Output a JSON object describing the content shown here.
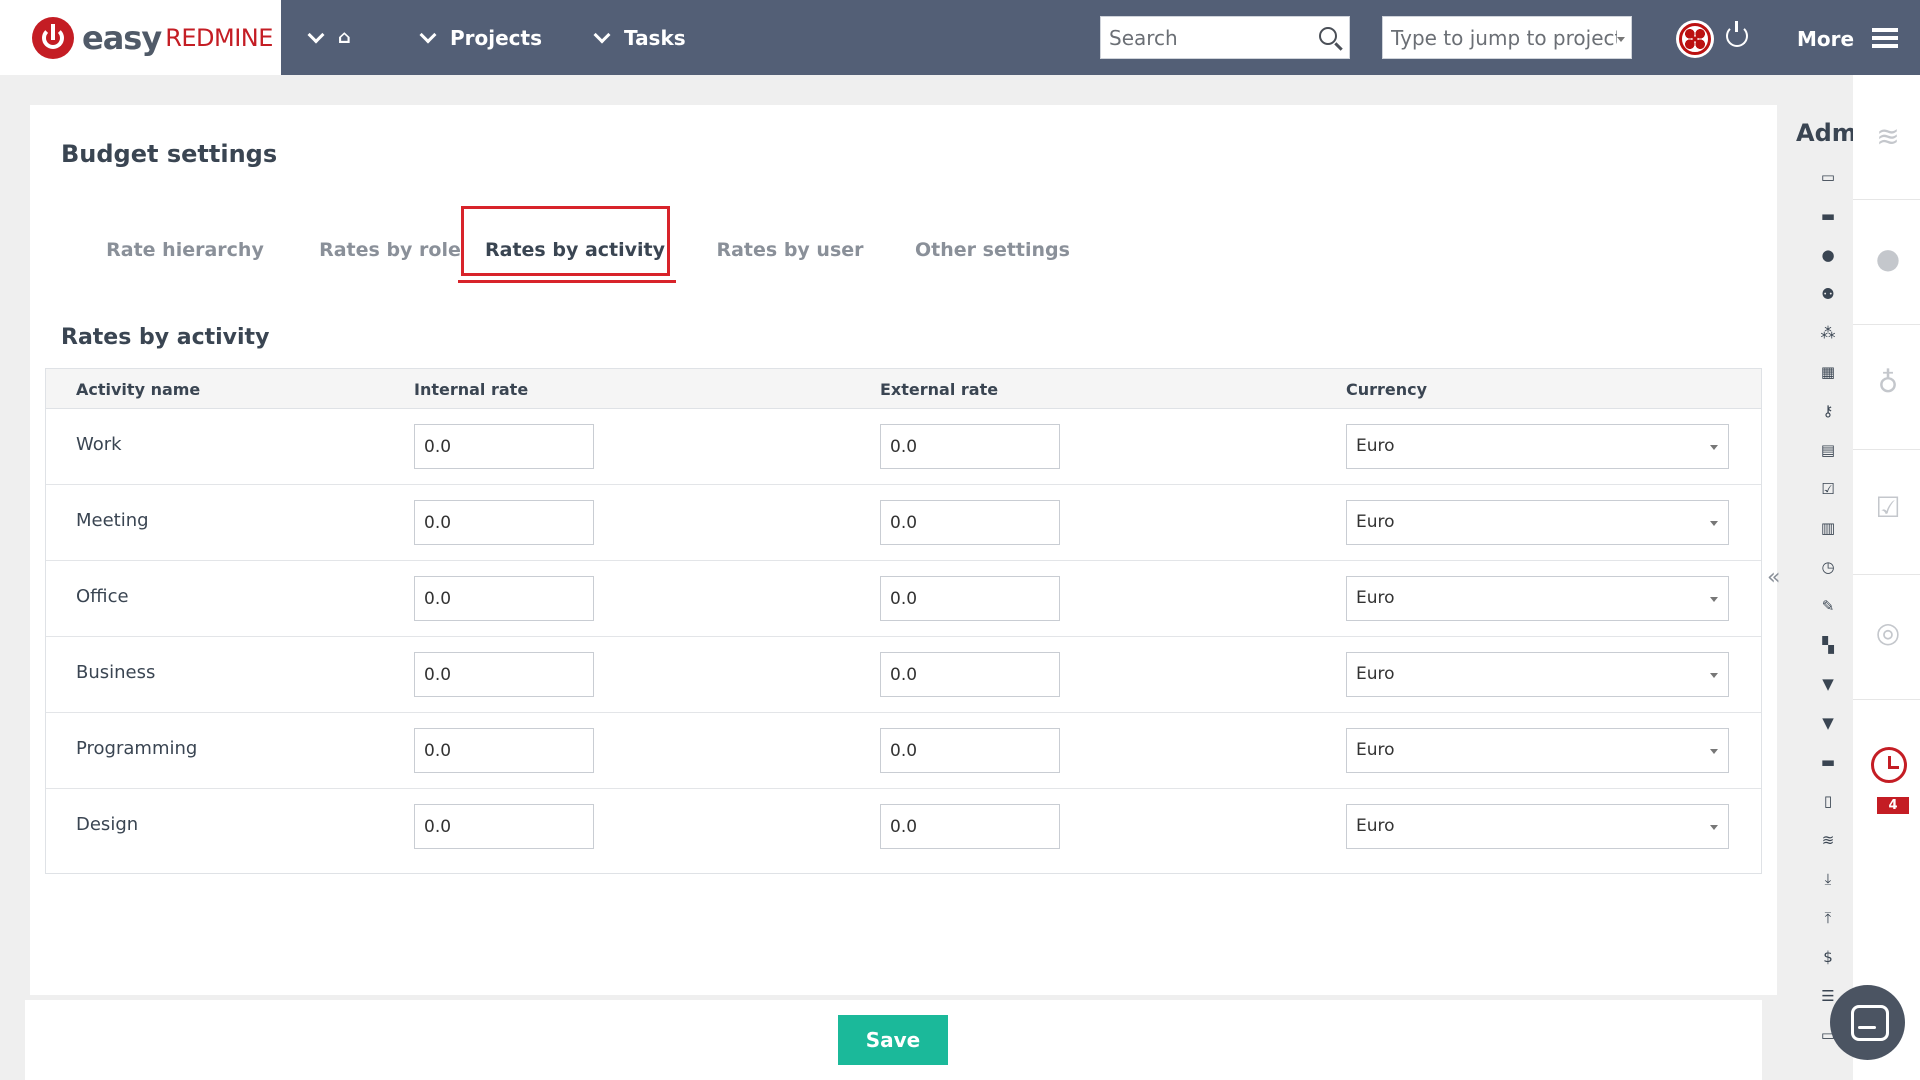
{
  "topbar": {
    "logo_easy": "easy",
    "logo_redmine": "REDMINE",
    "nav": [
      {
        "label": "Projects"
      },
      {
        "label": "Tasks"
      }
    ],
    "search_placeholder": "Search",
    "jump_placeholder": "Type to jump to project",
    "more_label": "More"
  },
  "page": {
    "title": "Budget settings",
    "tabs": [
      {
        "label": "Rate hierarchy"
      },
      {
        "label": "Rates by role"
      },
      {
        "label": "Rates by activity"
      },
      {
        "label": "Rates by user"
      },
      {
        "label": "Other settings"
      }
    ],
    "active_tab": "Rates by activity",
    "section_title": "Rates by activity"
  },
  "table": {
    "headers": {
      "name": "Activity name",
      "internal": "Internal rate",
      "external": "External rate",
      "currency": "Currency"
    },
    "rows": [
      {
        "name": "Work",
        "internal": "0.0",
        "external": "0.0",
        "currency": "Euro"
      },
      {
        "name": "Meeting",
        "internal": "0.0",
        "external": "0.0",
        "currency": "Euro"
      },
      {
        "name": "Office",
        "internal": "0.0",
        "external": "0.0",
        "currency": "Euro"
      },
      {
        "name": "Business",
        "internal": "0.0",
        "external": "0.0",
        "currency": "Euro"
      },
      {
        "name": "Programming",
        "internal": "0.0",
        "external": "0.0",
        "currency": "Euro"
      },
      {
        "name": "Design",
        "internal": "0.0",
        "external": "0.0",
        "currency": "Euro"
      }
    ]
  },
  "footer": {
    "save_label": "Save"
  },
  "admin": {
    "label": "Admi",
    "icons": [
      "folder-icon",
      "folder-filled-icon",
      "user-icon",
      "users-icon",
      "group-icon",
      "calendar-icon",
      "key-icon",
      "clipboard-icon",
      "checklist-icon",
      "calculator-icon",
      "history-icon",
      "edit-icon",
      "grid-icon",
      "filter-icon",
      "filter-alt-icon",
      "car-icon",
      "document-icon",
      "feed-icon",
      "download-icon",
      "upload-icon",
      "dollar-icon",
      "list-icon",
      "inbox-icon"
    ]
  },
  "right_strip": {
    "timer_badge": "4"
  },
  "colors": {
    "topbar": "#535f76",
    "brand_red": "#c41d24",
    "save_green": "#1bb99a",
    "highlight_red": "#d8232a"
  }
}
